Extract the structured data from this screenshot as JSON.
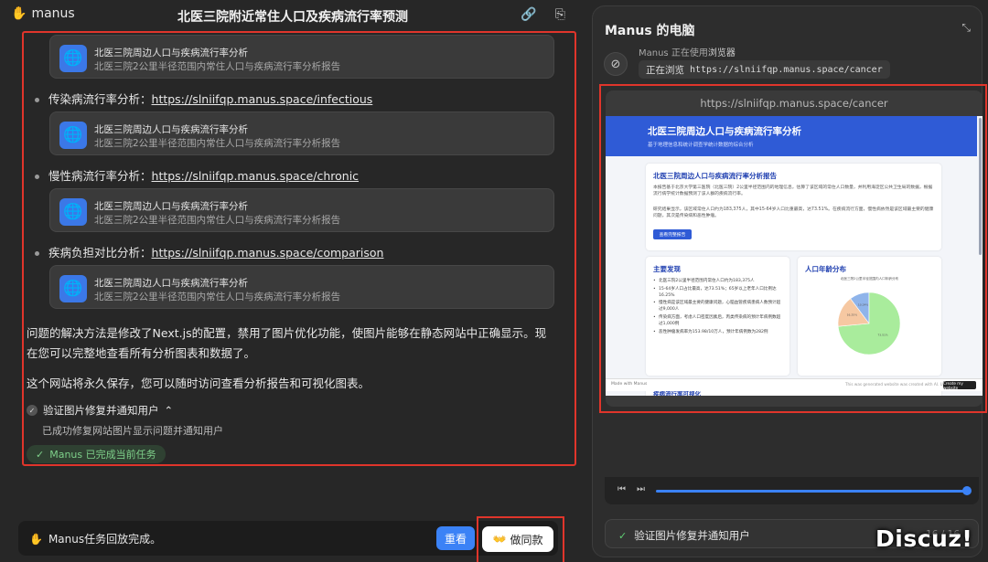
{
  "app": {
    "name": "manus",
    "logo_glyph": "✋",
    "title": "北医三院附近常住人口及疾病流行率预测"
  },
  "cards": [
    {
      "title": "北医三院周边人口与疾病流行率分析",
      "subtitle": "北医三院2公里半径范围内常住人口与疾病流行率分析报告"
    },
    {
      "title": "北医三院周边人口与疾病流行率分析",
      "subtitle": "北医三院2公里半径范围内常住人口与疾病流行率分析报告"
    },
    {
      "title": "北医三院周边人口与疾病流行率分析",
      "subtitle": "北医三院2公里半径范围内常住人口与疾病流行率分析报告"
    },
    {
      "title": "北医三院周边人口与疾病流行率分析",
      "subtitle": "北医三院2公里半径范围内常住人口与疾病流行率分析报告"
    }
  ],
  "bullets": [
    {
      "label": "传染病流行率分析：",
      "link": "https://slniifqp.manus.space/infectious"
    },
    {
      "label": "慢性病流行率分析：",
      "link": "https://slniifqp.manus.space/chronic"
    },
    {
      "label": "疾病负担对比分析：",
      "link": "https://slniifqp.manus.space/comparison"
    }
  ],
  "paragraphs": {
    "fix": "问题的解决方法是修改了Next.js的配置，禁用了图片优化功能，使图片能够在静态网站中正确显示。现在您可以完整地查看所有分析图表和数据了。",
    "permanent": "这个网站将永久保存，您可以随时访问查看分析报告和可视化图表。"
  },
  "step": {
    "title": "验证图片修复并通知用户",
    "chevron": "⌃",
    "detail": "已成功修复网站图片显示问题并通知用户"
  },
  "done_badge": "Manus 已完成当前任务",
  "bottom_bar": {
    "status": "Manus任务回放完成。",
    "view_button": "重看",
    "same_button": "做同款"
  },
  "computer": {
    "title": "Manus 的电脑",
    "agent_status_prefix": "Manus 正在使用",
    "agent_status_tool": "浏览器",
    "browsing_label": "正在浏览",
    "browsing_url": "https://slniifqp.manus.space/cancer",
    "url_bar": "https://slniifqp.manus.space/cancer"
  },
  "site": {
    "hero_title": "北医三院周边人口与疾病流行率分析",
    "hero_sub": "基于地理信息和统计调查学统计数据的综合分析",
    "report_title": "北医三院周边人口与疾病流行率分析报告",
    "report_p1": "本报告基于北京大学第三医院（北医三院）2公里半径范围内的地理信息，估算了该区域的常住人口数量，并利用海淀区公共卫生局的数据，根据流行病学统计数据预测了该人群的疾病流行率。",
    "report_p2": "研究结果显示，该区域常住人口约为183,375人，其中15-64岁人口比重最高，达73.51%。在疾病流行方面，慢性病依然是该区域最主要的健康问题，其次是传染病和恶性肿瘤。",
    "report_button": "查看完整报告",
    "findings_title": "主要发现",
    "findings": [
      "北医三院2公里半径范围内常住人口约为183,375人",
      "15-64岁人口占比最高，达73.51%；65岁以上老年人口比例达16.25%",
      "慢性病是该区域最主要的健康问题，心脑血管疾病患病人数预计超过9,000人",
      "传染病方面，考虑人口密度因素后，丙类传染病的预计年病例数超过1,000例",
      "恶性肿瘤发病率为153.98/10万人，预计年病例数为282例"
    ],
    "age_title": "人口年龄分布",
    "age_chart_caption": "北医三院2公里半径范围内人口年龄分布",
    "prevalence_title": "疾病流行率可视化",
    "made_with": "Made with Manus",
    "made_note": "This was generated website was created with AI. Use with caution.",
    "made_button": "Create my website"
  },
  "chart_data": {
    "type": "pie",
    "title": "北医三院2公里半径范围内人口年龄分布",
    "categories": [
      "0-14岁",
      "15-64岁",
      "65岁以上"
    ],
    "values": [
      10.24,
      73.51,
      16.25
    ],
    "colors": [
      "#8fb4ea",
      "#a9ec9c",
      "#f6c8a2"
    ]
  },
  "player": {
    "prev_icon": "⏮",
    "next_icon": "⏭",
    "progress": 1.0
  },
  "task_bar": {
    "label": "验证图片修复并通知用户",
    "count": "16 / 16"
  },
  "watermark": "Discuz!"
}
